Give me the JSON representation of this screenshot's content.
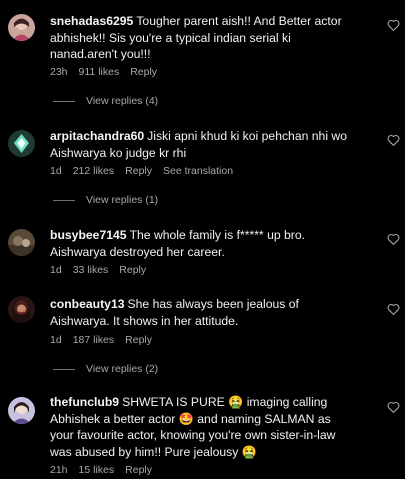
{
  "comments": [
    {
      "username": "snehadas6295",
      "text": "Tougher parent aish!! And Better actor abhishek!! Sis you're a typical indian serial ki nanad.aren't you!!!",
      "time": "23h",
      "likes": "911 likes",
      "reply": "Reply",
      "view_replies": "View replies (4)"
    },
    {
      "username": "arpitachandra60",
      "text": "Jiski apni khud ki koi pehchan nhi wo Aishwarya ko judge kr rhi",
      "time": "1d",
      "likes": "212 likes",
      "reply": "Reply",
      "see_translation": "See translation",
      "view_replies": "View replies (1)"
    },
    {
      "username": "busybee7145",
      "text": "The whole family is f***** up bro. Aishwarya destroyed her career.",
      "time": "1d",
      "likes": "33 likes",
      "reply": "Reply"
    },
    {
      "username": "conbeauty13",
      "text": "She has always been jealous of Aishwarya. It shows in her attitude.",
      "time": "1d",
      "likes": "187 likes",
      "reply": "Reply",
      "view_replies": "View replies (2)"
    },
    {
      "username": "thefunclub9",
      "text": "SHWETA IS PURE 🤮 imaging calling Abhishek a better actor 🤩 and naming SALMAN as your favourite actor, knowing you're own sister-in-law was abused by him!! Pure jealousy 🤮",
      "time": "21h",
      "likes": "15 likes",
      "reply": "Reply"
    }
  ],
  "icons": {
    "like": "heart-outline-icon"
  },
  "colors": {
    "background": "#000000",
    "text": "#f5f5f5",
    "muted": "#a8a8a8"
  }
}
